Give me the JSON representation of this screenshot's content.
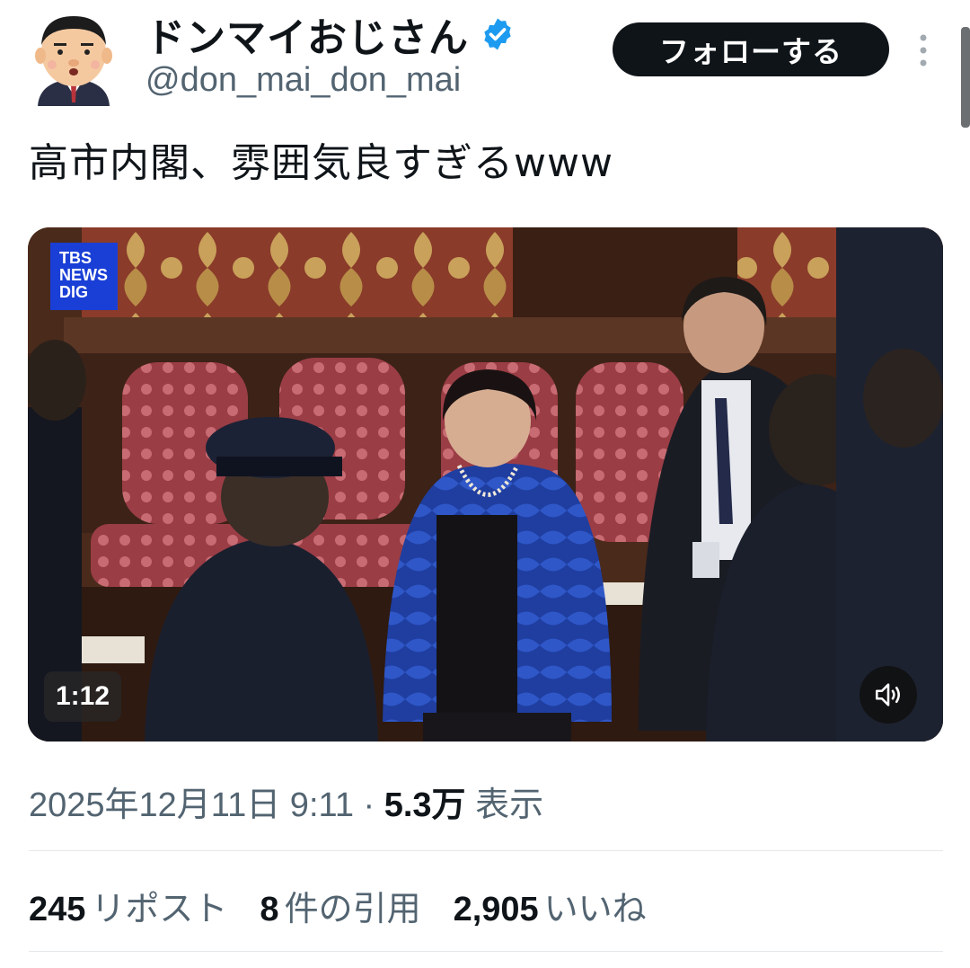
{
  "author": {
    "display_name": "ドンマイおじさん",
    "handle": "@don_mai_don_mai",
    "verified_color": "#1d9bf0"
  },
  "header": {
    "follow_label": "フォローする"
  },
  "tweet": {
    "text": "高市内閣、雰囲気良すぎるwww",
    "media": {
      "logo_lines": [
        "TBS",
        "NEWS",
        "DIG"
      ],
      "duration": "1:12"
    },
    "timestamp": "2025年12月11日 9:11",
    "views_count": "5.3万",
    "views_label": "表示"
  },
  "stats": {
    "reposts_count": "245",
    "reposts_label": "リポスト",
    "quotes_count": "8",
    "quotes_label": "件の引用",
    "likes_count": "2,905",
    "likes_label": "いいね"
  }
}
